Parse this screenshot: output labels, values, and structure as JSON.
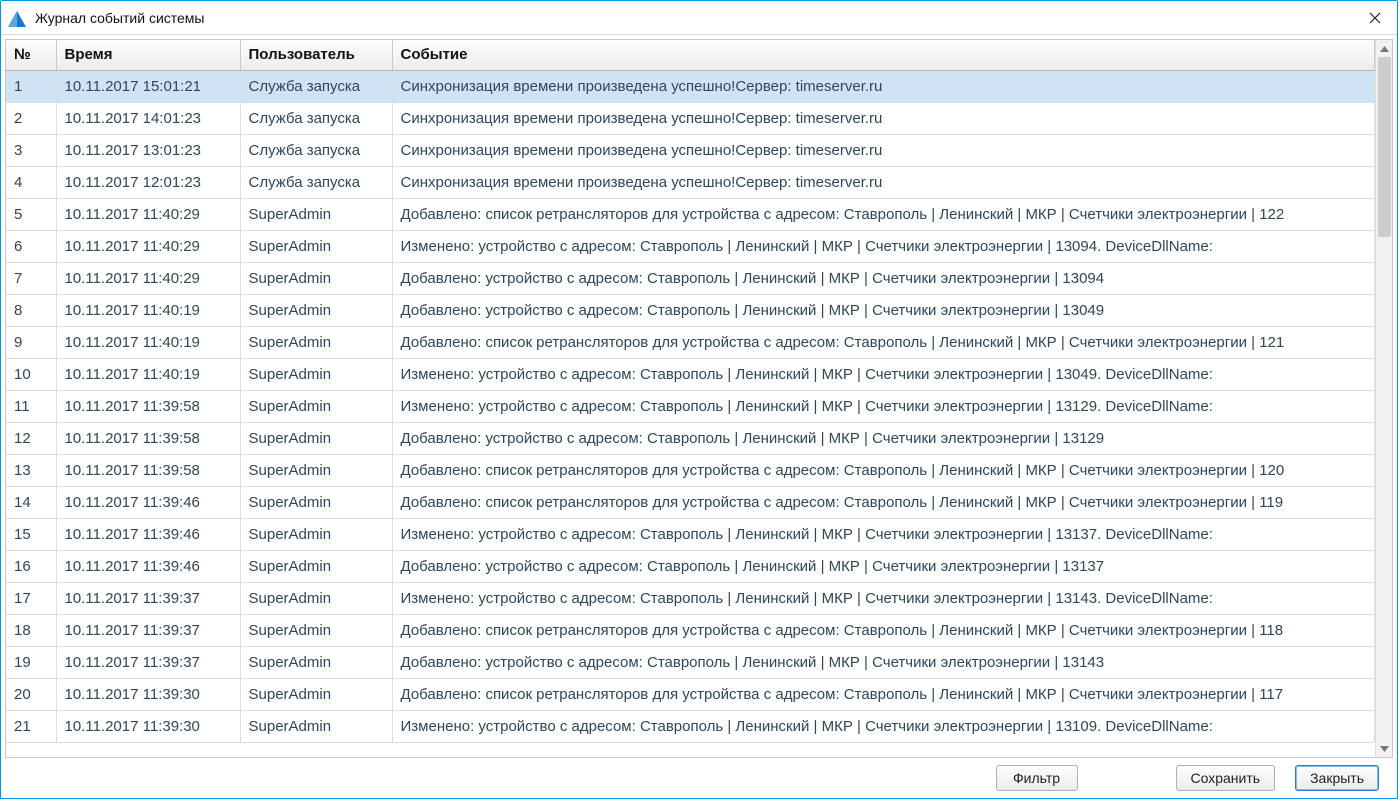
{
  "window": {
    "title": "Журнал событий системы"
  },
  "table": {
    "headers": {
      "num": "№",
      "time": "Время",
      "user": "Пользователь",
      "event": "Событие"
    },
    "rows": [
      {
        "num": "1",
        "time": "10.11.2017 15:01:21",
        "user": "Служба запуска",
        "event": "Синхронизация времени произведена успешно!Сервер: timeserver.ru",
        "selected": true
      },
      {
        "num": "2",
        "time": "10.11.2017 14:01:23",
        "user": "Служба запуска",
        "event": "Синхронизация времени произведена успешно!Сервер: timeserver.ru"
      },
      {
        "num": "3",
        "time": "10.11.2017 13:01:23",
        "user": "Служба запуска",
        "event": "Синхронизация времени произведена успешно!Сервер: timeserver.ru"
      },
      {
        "num": "4",
        "time": "10.11.2017 12:01:23",
        "user": "Служба запуска",
        "event": "Синхронизация времени произведена успешно!Сервер: timeserver.ru"
      },
      {
        "num": "5",
        "time": "10.11.2017 11:40:29",
        "user": "SuperAdmin",
        "event": "Добавлено: список ретрансляторов для устройства с адресом: Ставрополь | Ленинский | МКР | Счетчики электроэнергии | 122"
      },
      {
        "num": "6",
        "time": "10.11.2017 11:40:29",
        "user": "SuperAdmin",
        "event": "Изменено: устройство с адресом: Ставрополь | Ленинский | МКР | Счетчики электроэнергии | 13094. DeviceDllName:"
      },
      {
        "num": "7",
        "time": "10.11.2017 11:40:29",
        "user": "SuperAdmin",
        "event": "Добавлено: устройство с адресом: Ставрополь | Ленинский | МКР | Счетчики электроэнергии | 13094"
      },
      {
        "num": "8",
        "time": "10.11.2017 11:40:19",
        "user": "SuperAdmin",
        "event": "Добавлено: устройство с адресом: Ставрополь | Ленинский | МКР | Счетчики электроэнергии | 13049"
      },
      {
        "num": "9",
        "time": "10.11.2017 11:40:19",
        "user": "SuperAdmin",
        "event": "Добавлено: список ретрансляторов для устройства с адресом: Ставрополь | Ленинский | МКР | Счетчики электроэнергии | 121"
      },
      {
        "num": "10",
        "time": "10.11.2017 11:40:19",
        "user": "SuperAdmin",
        "event": "Изменено: устройство с адресом: Ставрополь | Ленинский | МКР | Счетчики электроэнергии | 13049. DeviceDllName:"
      },
      {
        "num": "11",
        "time": "10.11.2017 11:39:58",
        "user": "SuperAdmin",
        "event": "Изменено: устройство с адресом: Ставрополь | Ленинский | МКР | Счетчики электроэнергии | 13129. DeviceDllName:"
      },
      {
        "num": "12",
        "time": "10.11.2017 11:39:58",
        "user": "SuperAdmin",
        "event": "Добавлено: устройство с адресом: Ставрополь | Ленинский | МКР | Счетчики электроэнергии | 13129"
      },
      {
        "num": "13",
        "time": "10.11.2017 11:39:58",
        "user": "SuperAdmin",
        "event": "Добавлено: список ретрансляторов для устройства с адресом: Ставрополь | Ленинский | МКР | Счетчики электроэнергии | 120"
      },
      {
        "num": "14",
        "time": "10.11.2017 11:39:46",
        "user": "SuperAdmin",
        "event": "Добавлено: список ретрансляторов для устройства с адресом: Ставрополь | Ленинский | МКР | Счетчики электроэнергии | 119"
      },
      {
        "num": "15",
        "time": "10.11.2017 11:39:46",
        "user": "SuperAdmin",
        "event": "Изменено: устройство с адресом: Ставрополь | Ленинский | МКР | Счетчики электроэнергии | 13137. DeviceDllName:"
      },
      {
        "num": "16",
        "time": "10.11.2017 11:39:46",
        "user": "SuperAdmin",
        "event": "Добавлено: устройство с адресом: Ставрополь | Ленинский | МКР | Счетчики электроэнергии | 13137"
      },
      {
        "num": "17",
        "time": "10.11.2017 11:39:37",
        "user": "SuperAdmin",
        "event": "Изменено: устройство с адресом: Ставрополь | Ленинский | МКР | Счетчики электроэнергии | 13143. DeviceDllName:"
      },
      {
        "num": "18",
        "time": "10.11.2017 11:39:37",
        "user": "SuperAdmin",
        "event": "Добавлено: список ретрансляторов для устройства с адресом: Ставрополь | Ленинский | МКР | Счетчики электроэнергии | 118"
      },
      {
        "num": "19",
        "time": "10.11.2017 11:39:37",
        "user": "SuperAdmin",
        "event": "Добавлено: устройство с адресом: Ставрополь | Ленинский | МКР | Счетчики электроэнергии | 13143"
      },
      {
        "num": "20",
        "time": "10.11.2017 11:39:30",
        "user": "SuperAdmin",
        "event": "Добавлено: список ретрансляторов для устройства с адресом: Ставрополь | Ленинский | МКР | Счетчики электроэнергии | 117"
      },
      {
        "num": "21",
        "time": "10.11.2017 11:39:30",
        "user": "SuperAdmin",
        "event": "Изменено: устройство с адресом: Ставрополь | Ленинский | МКР | Счетчики электроэнергии | 13109. DeviceDllName:"
      }
    ]
  },
  "footer": {
    "filter_label": "Фильтр",
    "save_label": "Сохранить",
    "close_label": "Закрыть"
  }
}
